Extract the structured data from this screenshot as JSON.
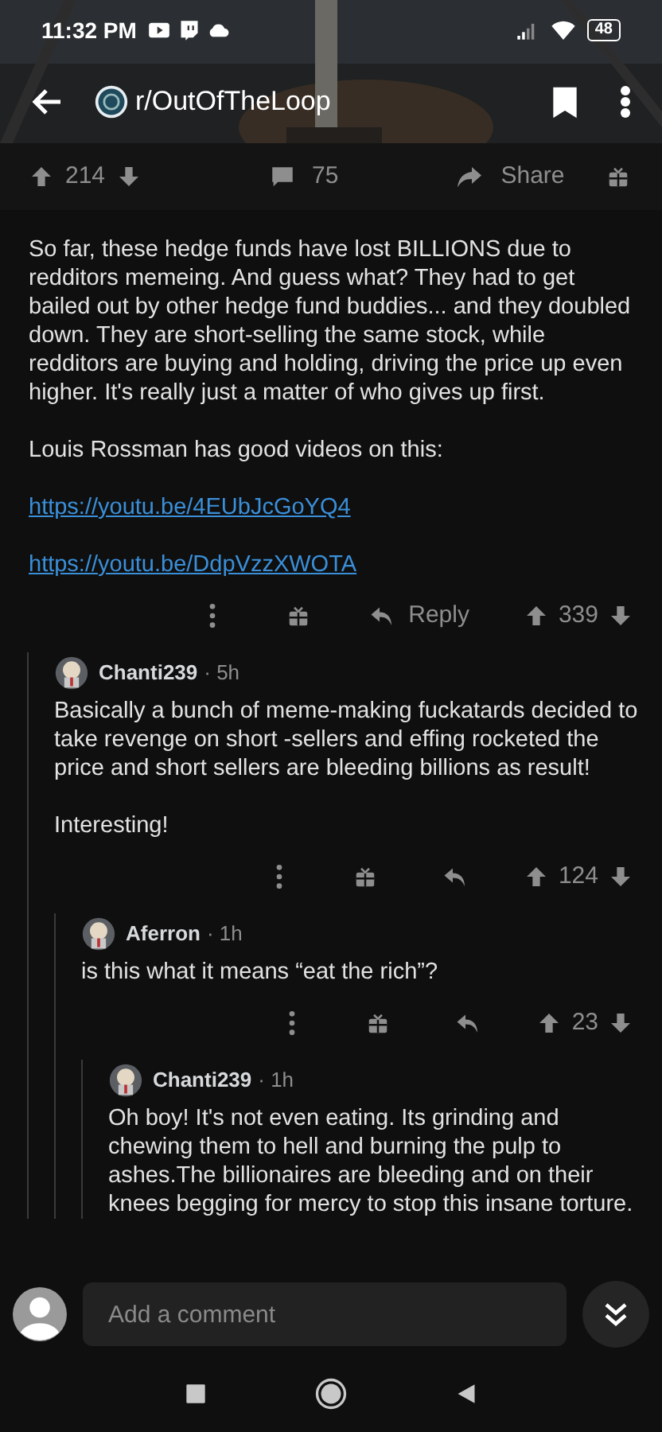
{
  "status_bar": {
    "time": "11:32 PM",
    "battery": "48"
  },
  "header": {
    "subreddit": "r/OutOfTheLoop"
  },
  "post_actions": {
    "upvotes": "214",
    "comments": "75",
    "share": "Share"
  },
  "thread": {
    "paragraphs": [
      {
        "kind": "text",
        "text": "So far, these hedge funds have lost BILLIONS due to redditors memeing.  And guess what?  They had to get bailed out by other hedge fund buddies... and they doubled down.  They are short-selling the same stock, while redditors are buying and holding, driving the price up even higher.  It's really just a matter of who gives up first."
      },
      {
        "kind": "text",
        "text": "Louis Rossman has good videos on this:"
      },
      {
        "kind": "link",
        "text": "https://youtu.be/4EUbJcGoYQ4"
      },
      {
        "kind": "link",
        "text": "https://youtu.be/DdpVzzXWOTA"
      }
    ],
    "reply_label": "Reply",
    "score": "339",
    "children": [
      {
        "author": "Chanti239",
        "time": "· 5h",
        "paragraphs": [
          {
            "kind": "text",
            "text": "Basically a bunch of meme-making fuckatards decided to take revenge on short -sellers and effing rocketed the price and short sellers are bleeding billions as result!"
          },
          {
            "kind": "text",
            "text": "Interesting!"
          }
        ],
        "score": "124",
        "children": [
          {
            "author": "Aferron",
            "time": "· 1h",
            "paragraphs": [
              {
                "kind": "text",
                "text": "is this what it means “eat the rich”?"
              }
            ],
            "score": "23",
            "children": [
              {
                "author": "Chanti239",
                "time": "· 1h",
                "paragraphs": [
                  {
                    "kind": "text",
                    "text": "Oh boy! It's not even eating. Its grinding and chewing them to hell and burning the pulp to ashes.The billionaires are bleeding and on their knees begging for mercy to stop this insane torture."
                  }
                ]
              }
            ]
          }
        ]
      }
    ]
  },
  "comment_box": {
    "placeholder": "Add a comment"
  }
}
